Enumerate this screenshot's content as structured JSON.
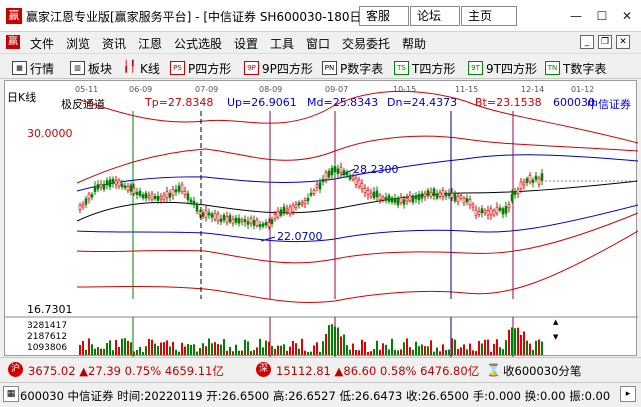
{
  "window": {
    "title": "赢家江恩专业版[赢家服务平台] - [中信证券  SH600030-180日",
    "buttons": [
      "客服",
      "论坛",
      "主页"
    ]
  },
  "menu": [
    "文件",
    "浏览",
    "资讯",
    "江恩",
    "公式选股",
    "设置",
    "工具",
    "窗口",
    "交易委托",
    "帮助"
  ],
  "toolbar": [
    {
      "label": "行情",
      "icon": "grid-icon"
    },
    {
      "label": "板块",
      "icon": "blocks-icon"
    },
    {
      "label": "K线",
      "icon": "candles-icon"
    },
    {
      "label": "P四方形",
      "icon": "ps-icon",
      "badge": "PS"
    },
    {
      "label": "9P四方形",
      "icon": "p9-icon",
      "badge": "9P"
    },
    {
      "label": "P数字表",
      "icon": "pn-icon",
      "badge": "PN"
    },
    {
      "label": "T四方形",
      "icon": "ts-icon",
      "badge": "TS"
    },
    {
      "label": "9T四方形",
      "icon": "t9-icon",
      "badge": "9T"
    },
    {
      "label": "T数字表",
      "icon": "tn-icon",
      "badge": "TN"
    }
  ],
  "chart": {
    "period": "日K线",
    "dates": [
      "05-11",
      "06-09",
      "07-09",
      "08-09",
      "09-07",
      "10-15",
      "11-15",
      "12-14",
      "01-12"
    ],
    "indicator": "极反通道",
    "tp": "Tp=27.8348",
    "up": "Up=26.9061",
    "md": "Md=25.8343",
    "dn": "Dn=24.4373",
    "bt": "Bt=23.1538",
    "code": "600030",
    "name": "中信证券",
    "price_high_label": "30.0000",
    "price_low_label": "16.7301",
    "annot_high": "28.2300",
    "annot_low": "22.0700",
    "vol_labels": [
      "3281417",
      "2187612",
      "1093806"
    ],
    "colors": {
      "candle_up": "#e00000",
      "candle_down": "#008000",
      "channel": "#d00000",
      "mid": "#0000c0",
      "axis_label": "#0000c8"
    }
  },
  "indexbar": {
    "sh_badge": "沪",
    "sh_text": "3675.02 ▲27.39 0.75% 4659.11亿",
    "sz_badge": "深",
    "sz_text": "15112.81 ▲86.60 0.58% 6476.80亿",
    "close_text": "收600030分笔"
  },
  "status": {
    "text": "600030 中信证券 时间:20220119 开:26.6500 高:26.6527 低:26.6473 收:26.6500 手:0.000 换:0.00 振:0.00"
  }
}
